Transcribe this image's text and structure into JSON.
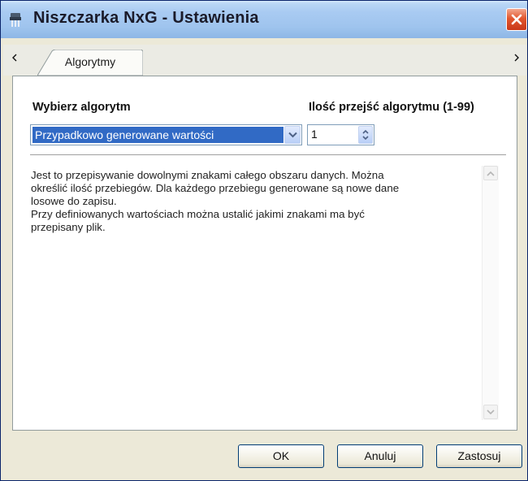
{
  "window": {
    "title": "Niszczarka NxG - Ustawienia",
    "icon": "shredder-icon",
    "close_icon": "close-icon"
  },
  "tabs": {
    "scroll_left_icon": "chevron-left-icon",
    "scroll_right_icon": "chevron-right-icon",
    "items": [
      {
        "label": "Algorytmy",
        "selected": true
      }
    ]
  },
  "algorithm": {
    "label": "Wybierz algorytm",
    "selected_value": "Przypadkowo generowane wartości",
    "dropdown_icon": "chevron-down-icon"
  },
  "passes": {
    "label": "Ilość przejść algorytmu (1-99)",
    "value": "1",
    "spin_icon": "spinner-updown-icon"
  },
  "description": {
    "text": "Jest to przepisywanie dowolnymi znakami całego obszaru danych. Można\nokreślić ilość przebiegów. Dla każdego przebiegu generowane są nowe dane\nlosowe do zapisu.\nPrzy definiowanych wartościach można ustalić jakimi znakami ma być\nprzepisany plik."
  },
  "buttons": {
    "ok": "OK",
    "cancel": "Anuluj",
    "apply": "Zastosuj"
  },
  "colors": {
    "selection": "#316ac5",
    "close_button": "#e2572f",
    "window_bg": "#ece9d8"
  }
}
